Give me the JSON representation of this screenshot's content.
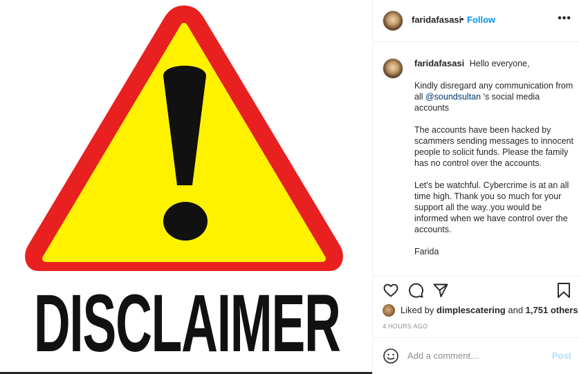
{
  "media": {
    "sign_text": "DISCLAIMER"
  },
  "header": {
    "username": "faridafasasi",
    "separator": "•",
    "follow_label": "Follow",
    "more_label": "•••"
  },
  "caption": {
    "username": "faridafasasi",
    "greeting": "Hello everyone,",
    "p1_before": "Kindly disregard any communication from all ",
    "p1_mention": "@soundsultan",
    "p1_after": " 's social media accounts",
    "p2": "The accounts have been hacked by scammers sending messages to innocent people to solicit funds. Please the family has no control over the accounts.",
    "p3": "Let's be watchful. Cybercrime is at an all time high. Thank you so much for your support all the way..you would be informed when we have control over the accounts.",
    "signoff": "Farida"
  },
  "actions": {
    "icons": [
      "heart-icon",
      "comment-icon",
      "share-icon",
      "bookmark-icon"
    ]
  },
  "likes": {
    "prefix": "Liked by ",
    "user": "dimplescatering",
    "middle": " and ",
    "count": "1,751 others"
  },
  "timestamp": "4 HOURS AGO",
  "comment": {
    "placeholder": "Add a comment…",
    "post_label": "Post"
  },
  "colors": {
    "accent": "#0095f6",
    "post_disabled": "#b2dffc",
    "warning_yellow": "#fff200",
    "warning_red": "#e8201f"
  }
}
